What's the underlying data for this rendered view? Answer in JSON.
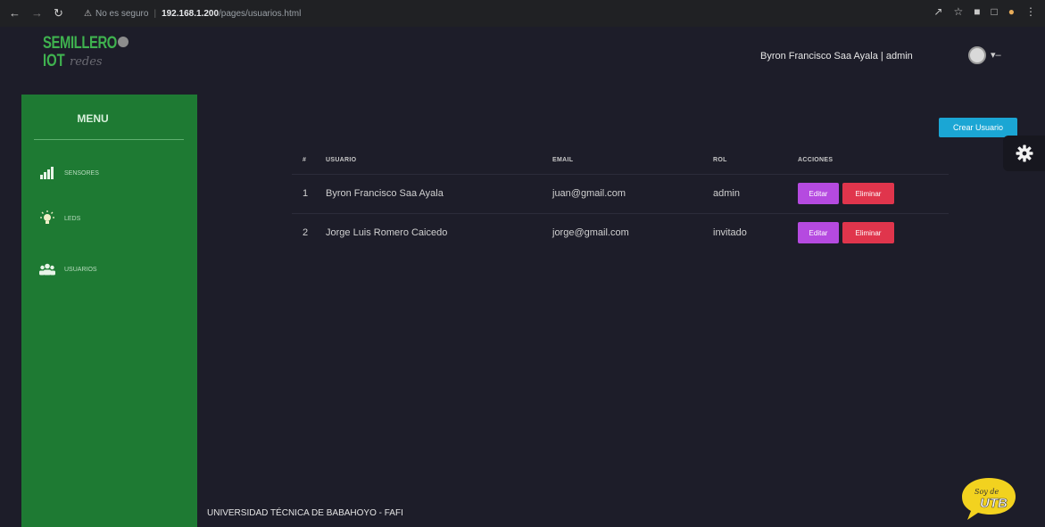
{
  "browser": {
    "security_label": "No es seguro",
    "host": "192.168.1.200",
    "path": "/pages/usuarios.html"
  },
  "logo": {
    "line1": "SEMILLERO",
    "line2": "IOT",
    "tagline": "redes"
  },
  "header": {
    "user": "Byron Francisco Saa Ayala | admin"
  },
  "sidebar": {
    "title": "MENU",
    "items": [
      {
        "label": "SENSORES",
        "icon": "signal-bars-icon"
      },
      {
        "label": "LEDS",
        "icon": "lightbulb-icon"
      },
      {
        "label": "USUARIOS",
        "icon": "users-icon"
      }
    ]
  },
  "main": {
    "create_button": "Crear Usuario"
  },
  "table": {
    "headers": [
      "#",
      "USUARIO",
      "EMAIL",
      "ROL",
      "ACCIONES"
    ],
    "rows": [
      {
        "n": "1",
        "user": "Byron Francisco Saa Ayala",
        "email": "juan@gmail.com",
        "role": "admin",
        "edit": "Editar",
        "delete": "Eliminar"
      },
      {
        "n": "2",
        "user": "Jorge Luis Romero Caicedo",
        "email": "jorge@gmail.com",
        "role": "invitado",
        "edit": "Editar",
        "delete": "Eliminar"
      }
    ]
  },
  "footer": {
    "text": "UNIVERSIDAD TÉCNICA DE BABAHOYO - FAFI"
  },
  "badge": {
    "line1": "Soy de",
    "line2": "UTB"
  },
  "colors": {
    "background": "#1d1d29",
    "sidebar": "#1e7a33",
    "edit": "#b54ae0",
    "delete": "#e0354c",
    "create": "#1ba6d4"
  }
}
